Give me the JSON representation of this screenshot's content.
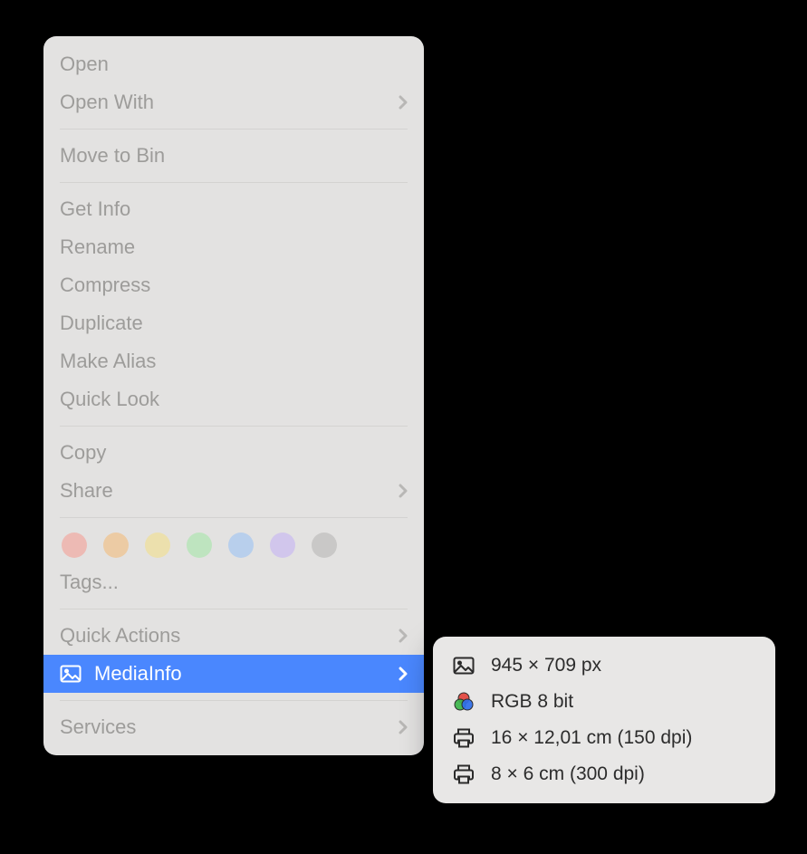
{
  "menu": {
    "open": "Open",
    "open_with": "Open With",
    "move_to_bin": "Move to Bin",
    "get_info": "Get Info",
    "rename": "Rename",
    "compress": "Compress",
    "duplicate": "Duplicate",
    "make_alias": "Make Alias",
    "quick_look": "Quick Look",
    "copy": "Copy",
    "share": "Share",
    "tags": "Tags...",
    "quick_actions": "Quick Actions",
    "mediainfo": "MediaInfo",
    "services": "Services"
  },
  "tag_colors": [
    "#edbab4",
    "#eccba4",
    "#ece0ad",
    "#bee4bf",
    "#b8cfec",
    "#d1c6ec",
    "#c9c8c7"
  ],
  "submenu": {
    "resolution": "945 × 709 px",
    "color": "RGB 8 bit",
    "print1": "16 × 12,01 cm (150 dpi)",
    "print2": "8 × 6 cm (300 dpi)"
  },
  "colors": {
    "selection": "#4a87fe"
  }
}
